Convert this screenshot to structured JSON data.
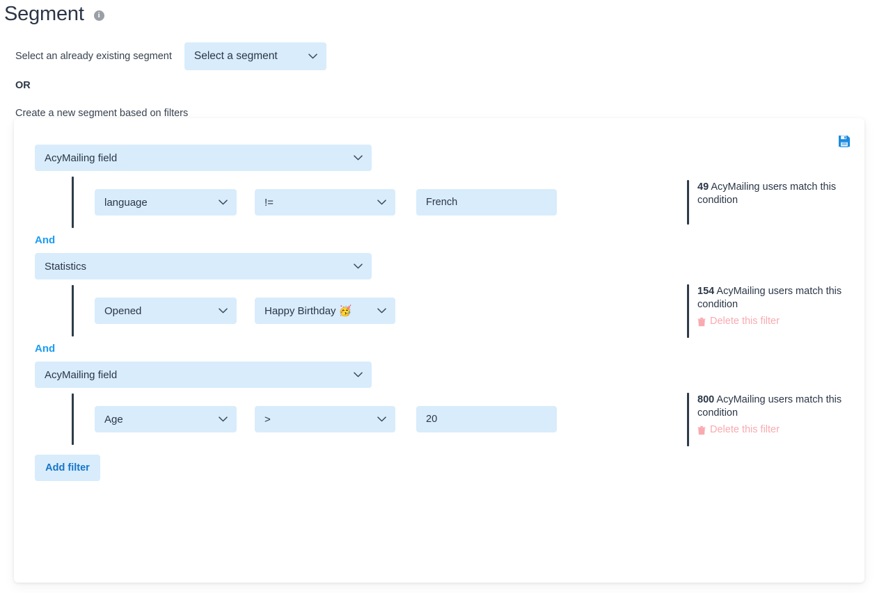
{
  "page": {
    "title": "Segment",
    "info_icon_char": "i"
  },
  "existing_segment": {
    "label": "Select an already existing segment",
    "selected": "Select a segment",
    "placeholder": "Select a segment"
  },
  "or_text": "OR",
  "create_text": "Create a new segment based on filters",
  "card": {
    "save_tooltip": "Save"
  },
  "colors": {
    "field_bg": "#d8ecfb",
    "accent_blue": "#1b9cf4",
    "link_blue": "#1675c9",
    "delete_pink": "#f9aab0",
    "bar_dark": "#2f3b48",
    "text_dark": "#2b3647"
  },
  "add_filter_label": "Add filter",
  "groups": [
    {
      "conjunction": null,
      "source": "AcyMailing field",
      "condition": {
        "field": "language",
        "operator": "!=",
        "value": "French",
        "value_is_input": true
      },
      "match": {
        "count": "49",
        "text": " AcyMailing users match this condition",
        "delete_label": "Delete this filter",
        "show_delete": false
      }
    },
    {
      "conjunction": "And",
      "source": "Statistics",
      "condition": {
        "field": "Opened",
        "operator": "Happy Birthday 🥳",
        "value": null,
        "value_is_input": false
      },
      "match": {
        "count": "154",
        "text": " AcyMailing users match this condition",
        "delete_label": "Delete this filter",
        "show_delete": true
      }
    },
    {
      "conjunction": "And",
      "source": "AcyMailing field",
      "condition": {
        "field": "Age",
        "operator": ">",
        "value": "20",
        "value_is_input": true
      },
      "match": {
        "count": "800",
        "text": " AcyMailing users match this condition",
        "delete_label": "Delete this filter",
        "show_delete": true
      }
    }
  ]
}
